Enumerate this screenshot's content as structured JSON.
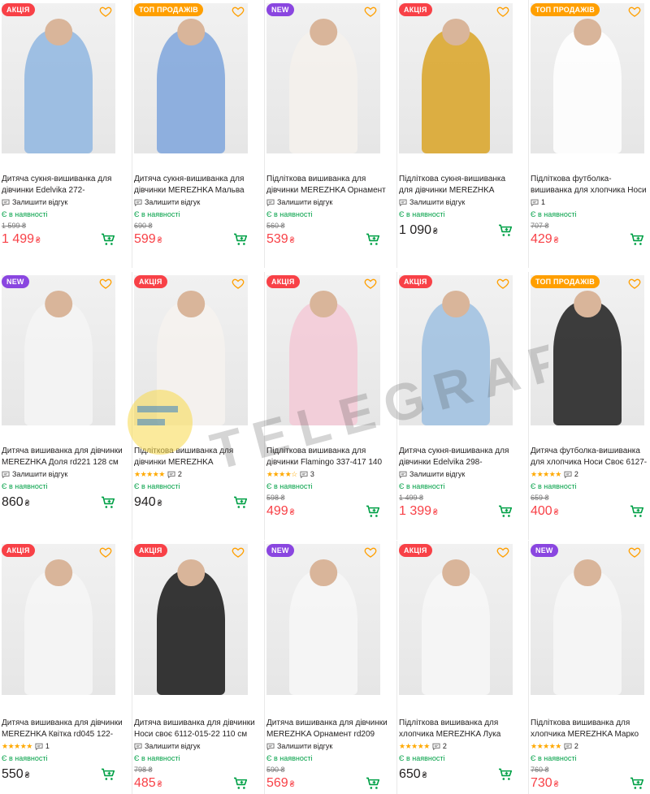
{
  "currency": "₴",
  "feedback_label": "Залишити відгук",
  "in_stock_label": "Є в наявності",
  "badge_colors": {
    "akcia": "#f84147",
    "top": "#ff9f00",
    "new": "#8a46e0"
  },
  "watermark_text": "TELEGRAF",
  "products": [
    {
      "badge": "АКЦІЯ",
      "badge_type": "akcia",
      "title": "Дитяча сукня-вишиванка для дівчинки Edelvika 272-",
      "stars": "",
      "reviews": "Залишити відгук",
      "stock": "Є в наявності",
      "old_price": "1 599 ₴",
      "price": "1 499",
      "price_color": "red",
      "outfit": "#8fb6e0"
    },
    {
      "badge": "ТОП ПРОДАЖІВ",
      "badge_type": "top",
      "title": "Дитяча сукня-вишиванка для дівчинки MEREZHKA Мальва",
      "stars": "",
      "reviews": "Залишити відгук",
      "stock": "Є в наявності",
      "old_price": "690 ₴",
      "price": "599",
      "price_color": "red",
      "outfit": "#7ea5dc"
    },
    {
      "badge": "NEW",
      "badge_type": "new",
      "title": "Підліткова вишиванка для дівчинки MEREZHKA Орнамент",
      "stars": "",
      "reviews": "Залишити відгук",
      "stock": "Є в наявності",
      "old_price": "560 ₴",
      "price": "539",
      "price_color": "red",
      "outfit": "#f4f1ec"
    },
    {
      "badge": "АКЦІЯ",
      "badge_type": "akcia",
      "title": "Підліткова сукня-вишиванка для дівчинки MEREZHKA",
      "stars": "",
      "reviews": "Залишити відгук",
      "stock": "Є в наявності",
      "old_price": "",
      "price": "1 090",
      "price_color": "black",
      "outfit": "#d9a325"
    },
    {
      "badge": "ТОП ПРОДАЖІВ",
      "badge_type": "top",
      "title": "Підліткова футболка-вишиванка для хлопчика Носи",
      "stars": "",
      "reviews": "1",
      "stock": "Є в наявності",
      "old_price": "707 ₴",
      "price": "429",
      "price_color": "red",
      "outfit": "#ffffff"
    },
    {
      "badge": "NEW",
      "badge_type": "new",
      "title": "Дитяча вишиванка для дівчинки MEREZHKA Доля rd221 128 см",
      "stars": "",
      "reviews": "Залишити відгук",
      "stock": "Є в наявності",
      "old_price": "",
      "price": "860",
      "price_color": "black",
      "outfit": "#f4f4f4"
    },
    {
      "badge": "АКЦІЯ",
      "badge_type": "akcia",
      "title": "Підліткова вишиванка для дівчинки MEREZHKA",
      "stars": "★★★★★",
      "reviews": "2",
      "stock": "Є в наявності",
      "old_price": "",
      "price": "940",
      "price_color": "black",
      "outfit": "#f6f2ee"
    },
    {
      "badge": "АКЦІЯ",
      "badge_type": "akcia",
      "title": "Підліткова вишиванка для дівчинки Flamingo 337-417 140",
      "stars": "★★★★☆",
      "reviews": "3",
      "stock": "Є в наявності",
      "old_price": "598 ₴",
      "price": "499",
      "price_color": "red",
      "outfit": "#f3c9d6"
    },
    {
      "badge": "АКЦІЯ",
      "badge_type": "akcia",
      "title": "Дитяча сукня-вишиванка для дівчинки Edelvika 298-",
      "stars": "",
      "reviews": "Залишити відгук",
      "stock": "Є в наявності",
      "old_price": "1 499 ₴",
      "price": "1 399",
      "price_color": "red",
      "outfit": "#9ebfe0"
    },
    {
      "badge": "ТОП ПРОДАЖІВ",
      "badge_type": "top",
      "title": "Дитяча футболка-вишиванка для хлопчика Носи Своє 6127-",
      "stars": "★★★★★",
      "reviews": "2",
      "stock": "Є в наявності",
      "old_price": "659 ₴",
      "price": "400",
      "price_color": "red",
      "outfit": "#1c1c1c"
    },
    {
      "badge": "АКЦІЯ",
      "badge_type": "akcia",
      "title": "Дитяча вишиванка для дівчинки MEREZHKA Квітка rd045 122-",
      "stars": "★★★★★",
      "reviews": "1",
      "stock": "Є в наявності",
      "old_price": "",
      "price": "550",
      "price_color": "black",
      "outfit": "#f6f6f6"
    },
    {
      "badge": "АКЦІЯ",
      "badge_type": "akcia",
      "title": "Дитяча вишиванка для дівчинки Носи своє 6112-015-22 110 см",
      "stars": "",
      "reviews": "Залишити відгук",
      "stock": "Є в наявності",
      "old_price": "798 ₴",
      "price": "485",
      "price_color": "red",
      "outfit": "#151515"
    },
    {
      "badge": "NEW",
      "badge_type": "new",
      "title": "Дитяча вишиванка для дівчинки MEREZHKA Орнамент rd209 122",
      "stars": "",
      "reviews": "Залишити відгук",
      "stock": "Є в наявності",
      "old_price": "590 ₴",
      "price": "569",
      "price_color": "red",
      "outfit": "#f7f7f7"
    },
    {
      "badge": "АКЦІЯ",
      "badge_type": "akcia",
      "title": "Підліткова вишиванка для хлопчика MEREZHKA Лука",
      "stars": "★★★★★",
      "reviews": "2",
      "stock": "Є в наявності",
      "old_price": "",
      "price": "650",
      "price_color": "black",
      "outfit": "#f7f7f7"
    },
    {
      "badge": "NEW",
      "badge_type": "new",
      "title": "Підліткова вишиванка для хлопчика MEREZHKA Марко",
      "stars": "★★★★★",
      "reviews": "2",
      "stock": "Є в наявності",
      "old_price": "760 ₴",
      "price": "730",
      "price_color": "red",
      "outfit": "#f7f7f7"
    }
  ]
}
